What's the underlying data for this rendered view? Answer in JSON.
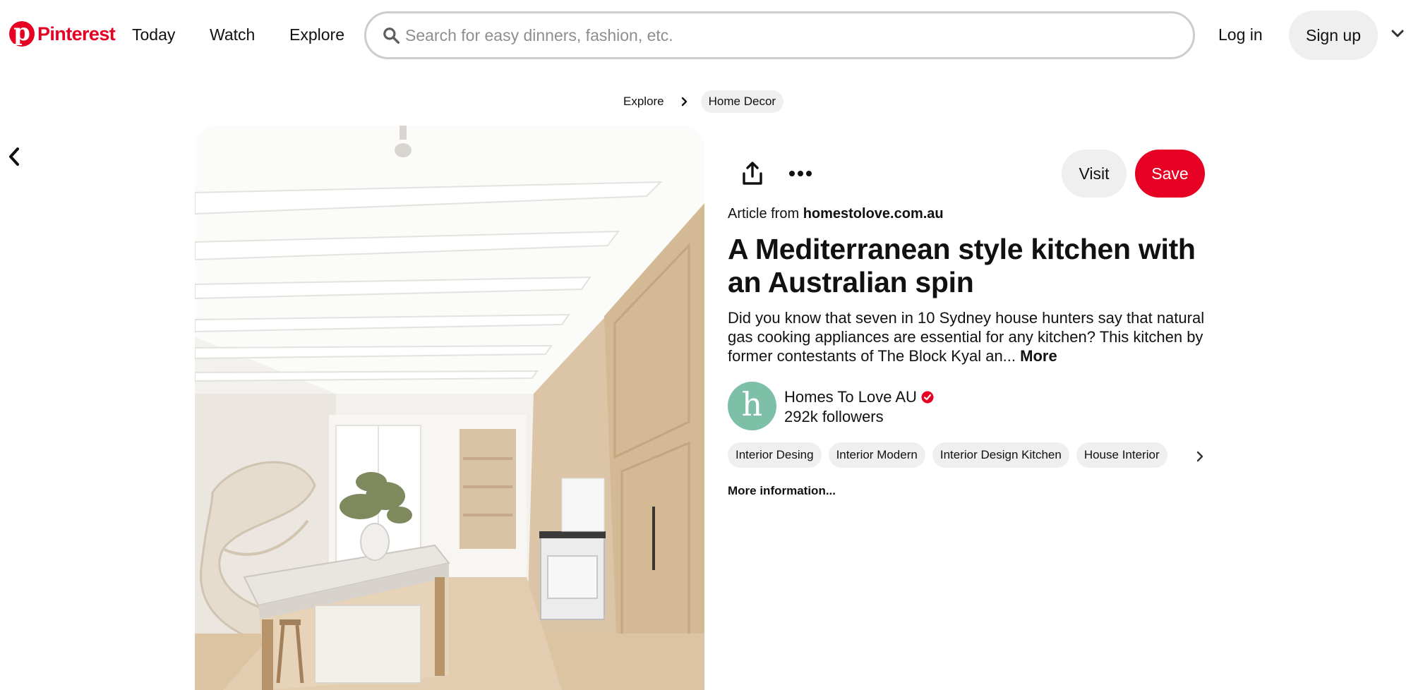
{
  "header": {
    "logo_text": "Pinterest",
    "nav": [
      {
        "label": "Today"
      },
      {
        "label": "Watch"
      },
      {
        "label": "Explore"
      }
    ],
    "search_placeholder": "Search for easy dinners, fashion, etc.",
    "login_label": "Log in",
    "signup_label": "Sign up"
  },
  "breadcrumb": {
    "root": "Explore",
    "current": "Home Decor"
  },
  "pin": {
    "image_alt": "Kitchen with timber cabinetry, marble island and spiral staircase",
    "visit_label": "Visit",
    "save_label": "Save",
    "article_prefix": "Article from",
    "article_domain": "homestolove.com.au",
    "title": "A Mediterranean style kitchen with an Australian spin",
    "description": "Did you know that seven in 10 Sydney house hunters say that natural gas cooking appliances are essential for any kitchen? This kitchen by former contestants of The Block Kyal an...",
    "description_more": "More",
    "creator": {
      "avatar_letter": "h",
      "name": "Homes To Love AU",
      "followers": "292k followers"
    },
    "tags": [
      "Interior Desing",
      "Interior Modern",
      "Interior Design Kitchen",
      "House Interior"
    ],
    "more_info": "More information..."
  },
  "colors": {
    "brand": "#e60023",
    "pill_bg": "#efefef",
    "avatar_bg": "#7dbfa7"
  },
  "icons": [
    "pinterest-logo-icon",
    "search-icon",
    "chevron-down-icon",
    "chevron-right-icon",
    "back-arrow-icon",
    "share-icon",
    "more-options-icon",
    "verified-badge-icon"
  ]
}
